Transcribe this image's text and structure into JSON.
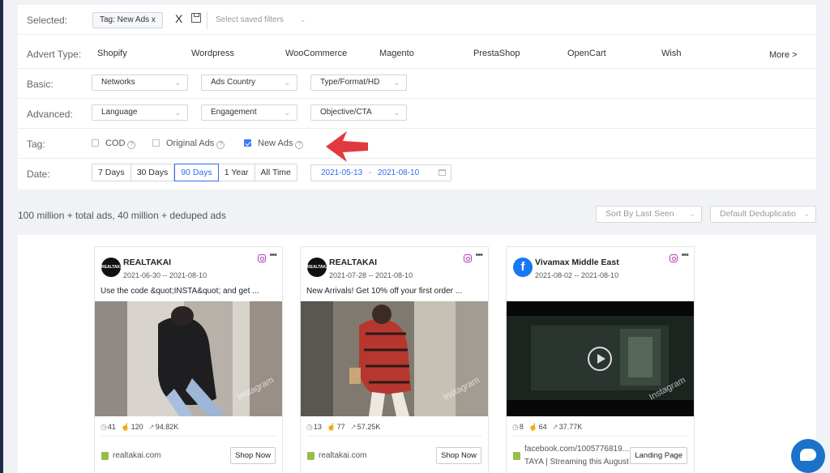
{
  "filters": {
    "selected": {
      "label": "Selected:",
      "chip": "Tag: New Ads  x",
      "clear": "X",
      "saved_placeholder": "Select saved filters"
    },
    "advert_type": {
      "label": "Advert Type:",
      "options": [
        "Shopify",
        "Wordpress",
        "WooCommerce",
        "Magento",
        "PrestaShop",
        "OpenCart",
        "Wish"
      ],
      "more": "More >"
    },
    "basic": {
      "label": "Basic:",
      "selects": [
        "Networks",
        "Ads Country",
        "Type/Format/HD"
      ]
    },
    "advanced": {
      "label": "Advanced:",
      "selects": [
        "Language",
        "Engagement",
        "Objective/CTA"
      ]
    },
    "tag": {
      "label": "Tag:",
      "options": [
        {
          "label": "COD",
          "checked": false
        },
        {
          "label": "Original Ads",
          "checked": false
        },
        {
          "label": "New Ads",
          "checked": true
        }
      ]
    },
    "date": {
      "label": "Date:",
      "ranges": [
        "7 Days",
        "30 Days",
        "90 Days",
        "1 Year",
        "All Time"
      ],
      "active_range": "90 Days",
      "start": "2021-05-13",
      "separator": "-",
      "end": "2021-08-10"
    }
  },
  "summary": "100 million + total ads, 40 million + deduped ads",
  "sort": {
    "sort_by": "Sort By Last Seen",
    "dedup": "Default Deduplicatio"
  },
  "cards": [
    {
      "name": "REALTAKAI",
      "avatar": "REALTAKAI",
      "dates": "2021-06-30 -- 2021-08-10",
      "text": "Use the code &quot;INSTA&quot; and get ...",
      "watermark": "Instagram",
      "stats": [
        "41",
        "120",
        "94.82K"
      ],
      "link": "realtakai.com",
      "cta": "Shop Now"
    },
    {
      "name": "REALTAKAI",
      "avatar": "REALTAKAI",
      "dates": "2021-07-28 -- 2021-08-10",
      "text": "New Arrivals! Get 10% off your first order ...",
      "watermark": "Instagram",
      "stats": [
        "13",
        "77",
        "57.25K"
      ],
      "link": "realtakai.com",
      "cta": "Shop Now"
    },
    {
      "name": "Vivamax Middle East",
      "avatar": "f",
      "dates": "2021-08-02 -- 2021-08-10",
      "text": "",
      "watermark": "Instagram",
      "stats": [
        "8",
        "64",
        "37.77K"
      ],
      "link": "facebook.com/1005776819...",
      "link_sub": "TAYA | Streaming this August ...",
      "cta": "Landing Page"
    }
  ],
  "colors": {
    "accent": "#2f6fed",
    "arrow": "#e03a3e",
    "instagram": "#b13ab5",
    "facebook": "#1877f2",
    "shopify": "#95bf47",
    "chat": "#1a73c8"
  }
}
